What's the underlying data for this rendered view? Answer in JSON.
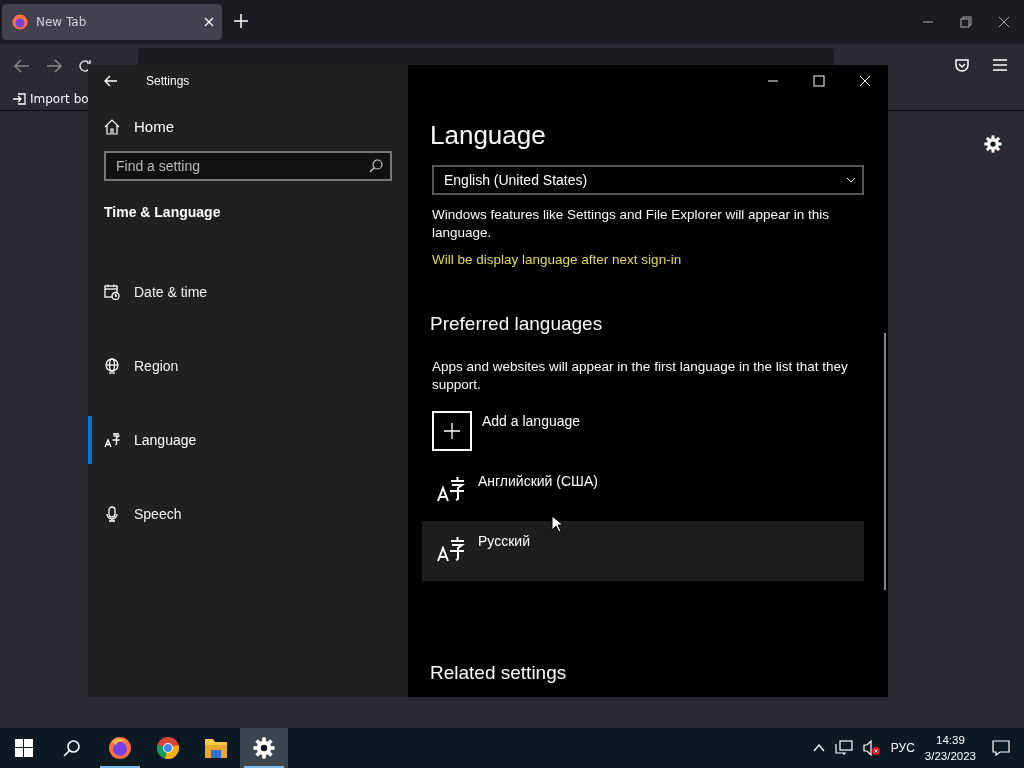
{
  "browser": {
    "tab": {
      "title": "New Tab",
      "selected": true
    },
    "bookmarks": [
      {
        "label": "Import bo"
      }
    ]
  },
  "settings_window": {
    "title": "Settings",
    "sidebar": {
      "home": "Home",
      "search": {
        "placeholder": "Find a setting"
      },
      "section": "Time & Language",
      "items": [
        {
          "label": "Date & time",
          "selected": false
        },
        {
          "label": "Region",
          "selected": false
        },
        {
          "label": "Language",
          "selected": true
        },
        {
          "label": "Speech",
          "selected": false
        }
      ]
    },
    "content": {
      "heading": "Language",
      "display_language": {
        "value": "English (United States)"
      },
      "note": "Windows features like Settings and File Explorer will appear in this language.",
      "notice": "Will be display language after next sign-in",
      "preferred_heading": "Preferred languages",
      "preferred_note": "Apps and websites will appear in the first language in the list that they support.",
      "add_button": "Add a language",
      "languages": [
        {
          "name": "Английский (США)",
          "highlighted": false
        },
        {
          "name": "Русский",
          "highlighted": true
        }
      ],
      "related_heading": "Related settings"
    }
  },
  "taskbar": {
    "apps": [
      {
        "kind": "firefox",
        "open": true,
        "active": false
      },
      {
        "kind": "chrome",
        "open": false,
        "active": false
      },
      {
        "kind": "explorer",
        "open": false,
        "active": false
      },
      {
        "kind": "settings",
        "open": true,
        "active": true
      }
    ],
    "input_language": "РУС",
    "time": "14:39",
    "date": "3/23/2023"
  }
}
